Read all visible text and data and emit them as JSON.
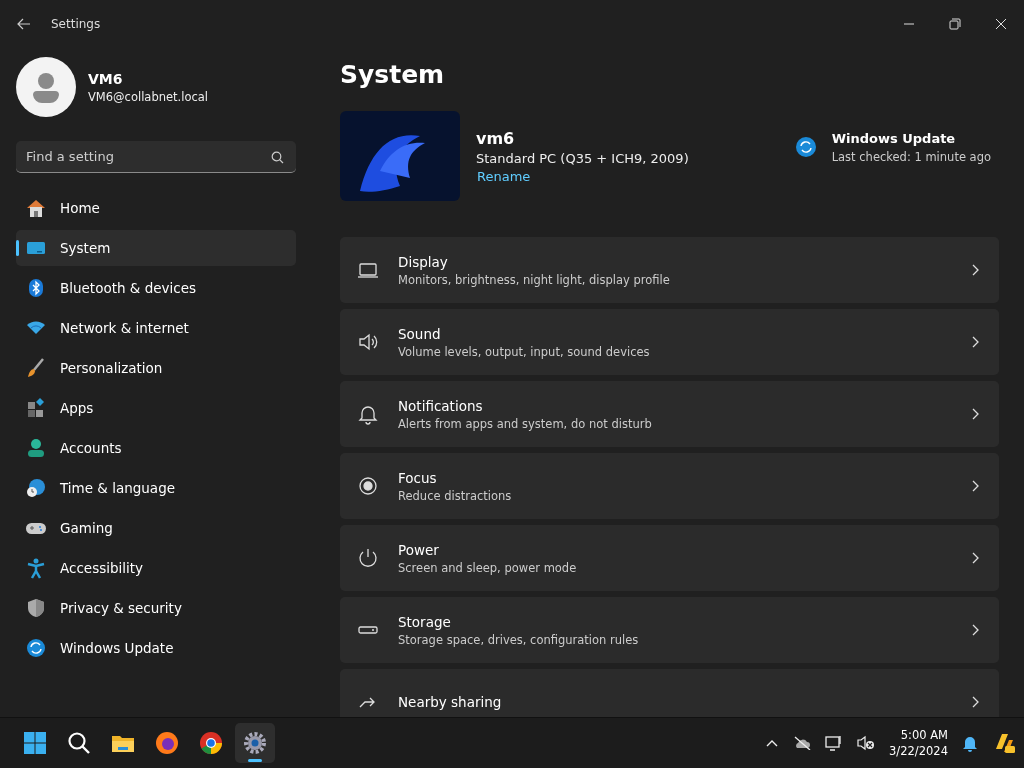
{
  "window": {
    "title": "Settings"
  },
  "account": {
    "name": "VM6",
    "email": "VM6@collabnet.local"
  },
  "search": {
    "placeholder": "Find a setting"
  },
  "sidebar": {
    "items": [
      {
        "label": "Home",
        "kind": "home",
        "selected": false
      },
      {
        "label": "System",
        "kind": "system",
        "selected": true
      },
      {
        "label": "Bluetooth & devices",
        "kind": "bluetooth",
        "selected": false
      },
      {
        "label": "Network & internet",
        "kind": "network",
        "selected": false
      },
      {
        "label": "Personalization",
        "kind": "brush",
        "selected": false
      },
      {
        "label": "Apps",
        "kind": "apps",
        "selected": false
      },
      {
        "label": "Accounts",
        "kind": "accounts",
        "selected": false
      },
      {
        "label": "Time & language",
        "kind": "time",
        "selected": false
      },
      {
        "label": "Gaming",
        "kind": "gaming",
        "selected": false
      },
      {
        "label": "Accessibility",
        "kind": "accessibility",
        "selected": false
      },
      {
        "label": "Privacy & security",
        "kind": "privacy",
        "selected": false
      },
      {
        "label": "Windows Update",
        "kind": "update",
        "selected": false
      }
    ]
  },
  "page": {
    "title": "System"
  },
  "device": {
    "name": "vm6",
    "model": "Standard PC (Q35 + ICH9, 2009)",
    "rename": "Rename"
  },
  "update": {
    "title": "Windows Update",
    "status": "Last checked: 1 minute ago"
  },
  "cards": [
    {
      "title": "Display",
      "subtitle": "Monitors, brightness, night light, display profile",
      "kind": "display"
    },
    {
      "title": "Sound",
      "subtitle": "Volume levels, output, input, sound devices",
      "kind": "sound"
    },
    {
      "title": "Notifications",
      "subtitle": "Alerts from apps and system, do not disturb",
      "kind": "bell"
    },
    {
      "title": "Focus",
      "subtitle": "Reduce distractions",
      "kind": "focus"
    },
    {
      "title": "Power",
      "subtitle": "Screen and sleep, power mode",
      "kind": "power"
    },
    {
      "title": "Storage",
      "subtitle": "Storage space, drives, configuration rules",
      "kind": "storage"
    },
    {
      "title": "Nearby sharing",
      "kind": "share"
    }
  ],
  "taskbar": {
    "apps": [
      {
        "kind": "start",
        "selected": false
      },
      {
        "kind": "search",
        "selected": false
      },
      {
        "kind": "folder",
        "selected": false
      },
      {
        "kind": "firefox",
        "selected": false
      },
      {
        "kind": "chrome",
        "selected": false
      },
      {
        "kind": "gear",
        "selected": true
      }
    ],
    "time": "5:00 AM",
    "date": "3/22/2024"
  }
}
